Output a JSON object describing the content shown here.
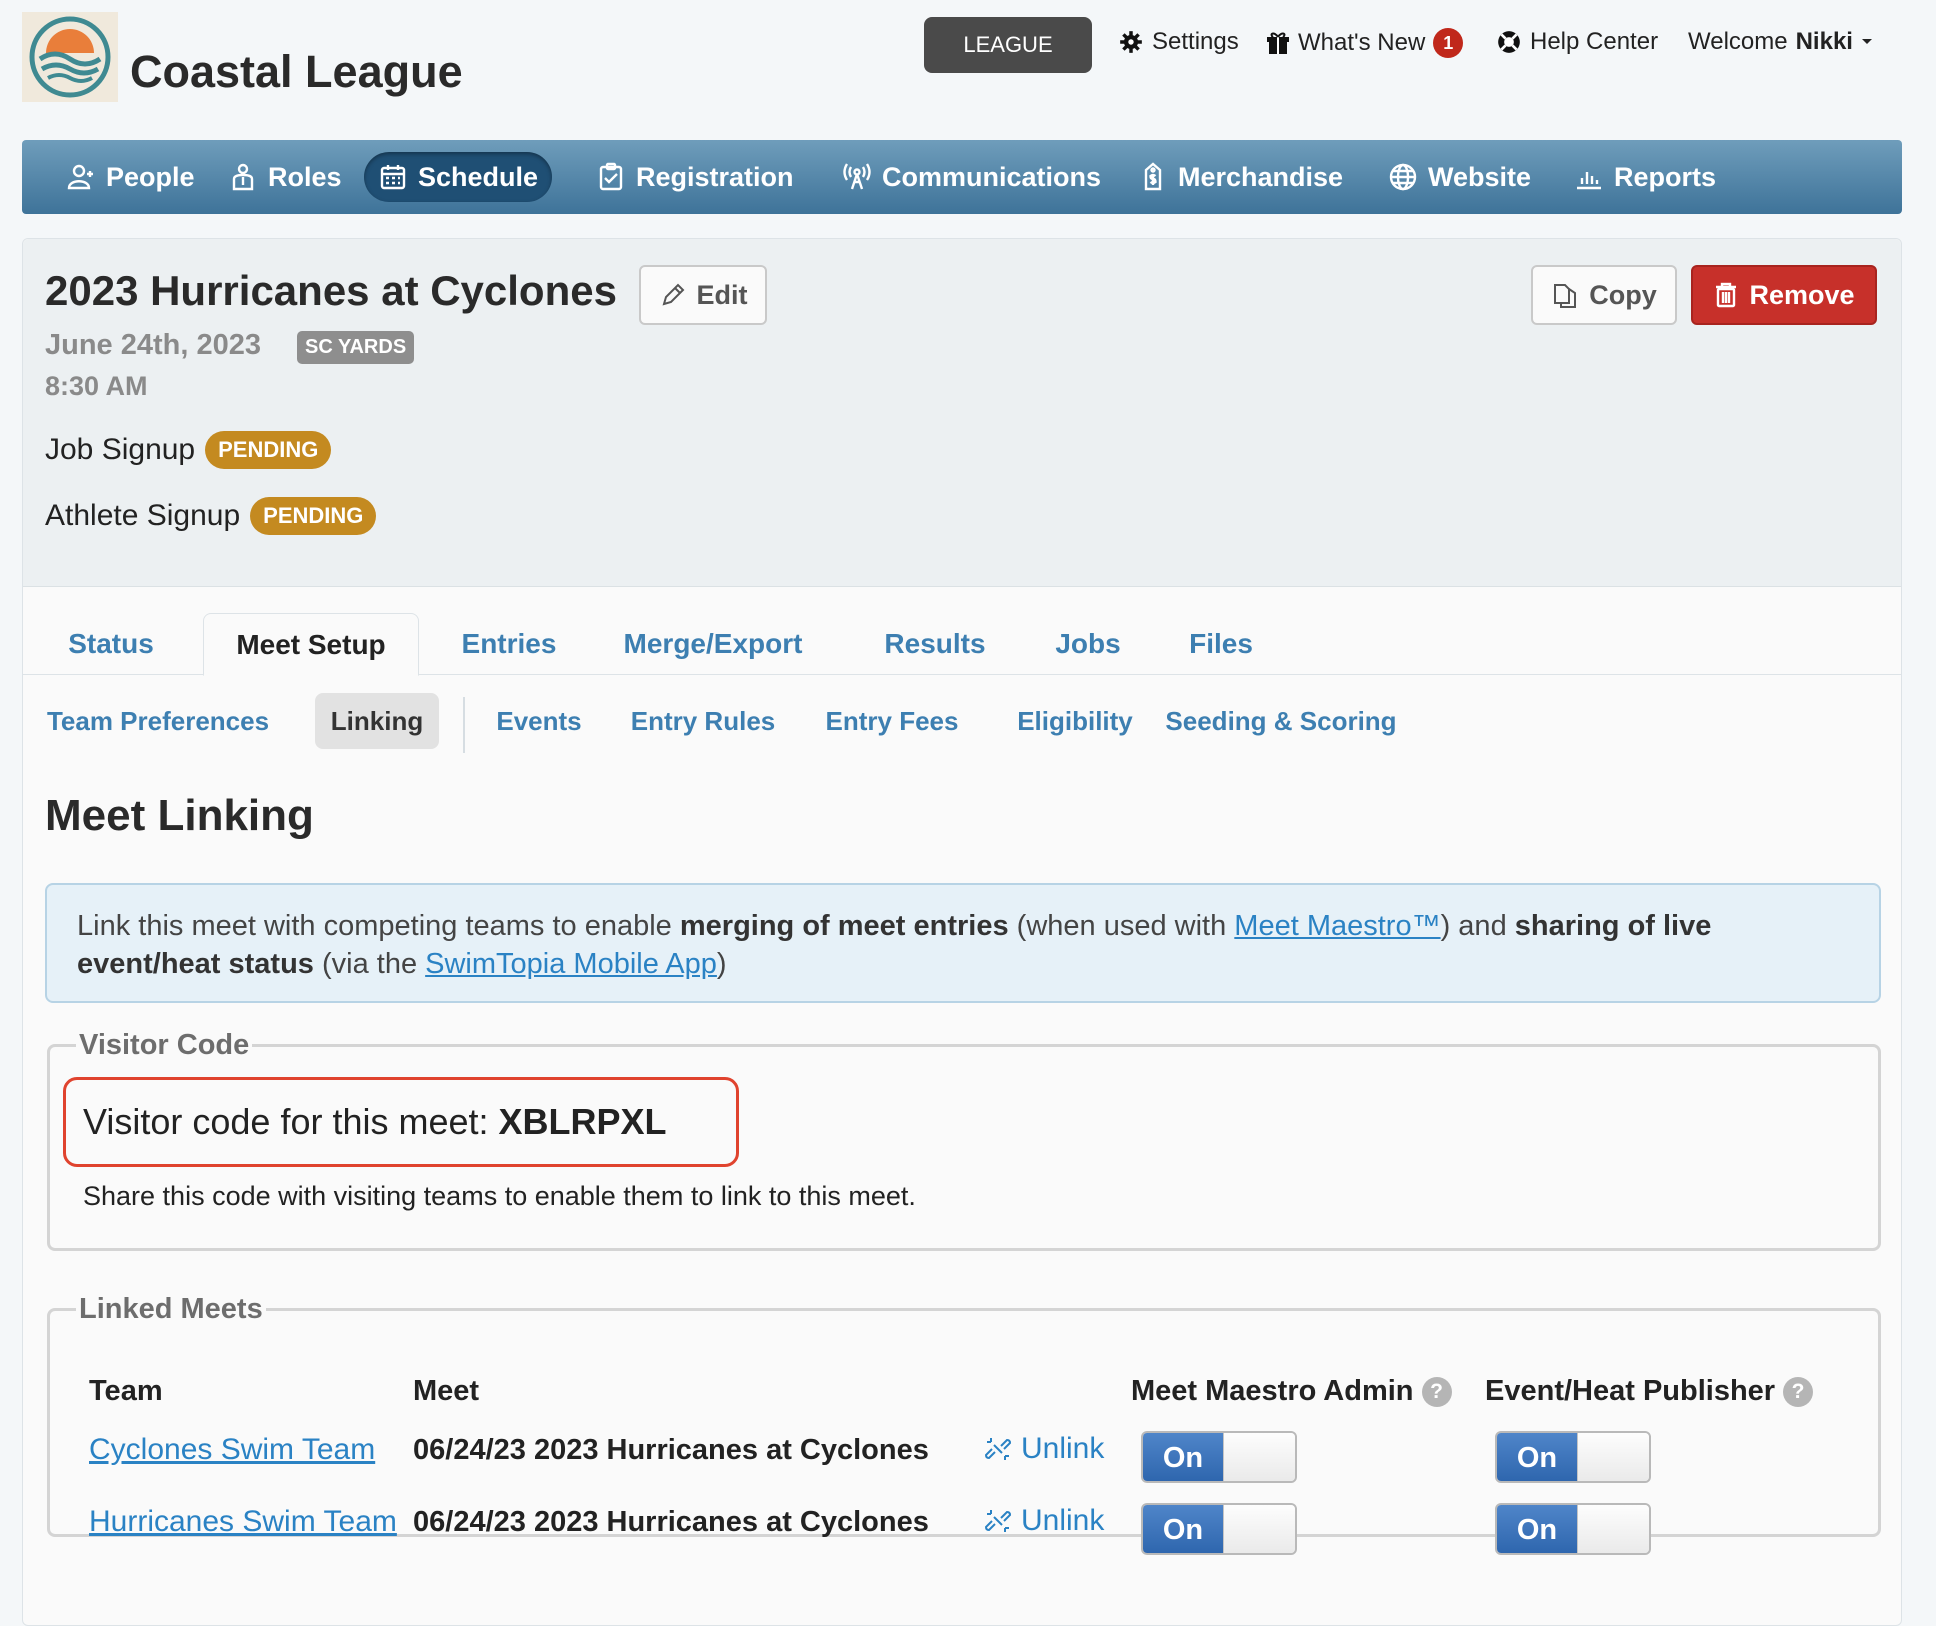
{
  "header": {
    "league_name": "Coastal League",
    "league_button": "LEAGUE",
    "settings": "Settings",
    "whats_new": "What's New",
    "whats_new_count": "1",
    "help_center": "Help Center",
    "welcome_prefix": "Welcome",
    "user_name": "Nikki"
  },
  "nav": {
    "people": "People",
    "roles": "Roles",
    "schedule": "Schedule",
    "registration": "Registration",
    "communications": "Communications",
    "merchandise": "Merchandise",
    "website": "Website",
    "reports": "Reports",
    "active": "Schedule"
  },
  "event": {
    "title": "2023 Hurricanes at Cyclones",
    "edit_label": "Edit",
    "copy_label": "Copy",
    "remove_label": "Remove",
    "date": "June 24th, 2023",
    "course": "SC YARDS",
    "time": "8:30 AM",
    "job_signup_label": "Job Signup",
    "job_signup_status": "PENDING",
    "athlete_signup_label": "Athlete Signup",
    "athlete_signup_status": "PENDING"
  },
  "tabs": [
    "Status",
    "Meet Setup",
    "Entries",
    "Merge/Export",
    "Results",
    "Jobs",
    "Files"
  ],
  "active_tab": "Meet Setup",
  "subtabs": [
    "Team Preferences",
    "Linking",
    "Events",
    "Entry Rules",
    "Entry Fees",
    "Eligibility",
    "Seeding & Scoring"
  ],
  "active_subtab": "Linking",
  "main": {
    "title": "Meet Linking",
    "info": {
      "part1": "Link this meet with competing teams to enable ",
      "bold1": "merging of meet entries",
      "part2": " (when used with ",
      "link1": "Meet Maestro™",
      "part3": ") and ",
      "bold2": "sharing of live event/heat status",
      "part4": " (via the ",
      "link2": "SwimTopia Mobile App",
      "part5": ")"
    },
    "visitor": {
      "legend": "Visitor Code",
      "prefix": "Visitor code for this meet: ",
      "code": "XBLRPXL",
      "note": "Share this code with visiting teams to enable them to link to this meet."
    },
    "linked": {
      "legend": "Linked Meets",
      "headers": {
        "team": "Team",
        "meet": "Meet",
        "admin": "Meet Maestro Admin",
        "publisher": "Event/Heat Publisher"
      },
      "help_glyph": "?",
      "unlink_label": "Unlink",
      "toggle_label": "On",
      "rows": [
        {
          "team": "Cyclones Swim Team",
          "meet": "06/24/23 2023 Hurricanes at Cyclones",
          "admin": "On",
          "publisher": "On"
        },
        {
          "team": "Hurricanes Swim Team",
          "meet": "06/24/23 2023 Hurricanes at Cyclones",
          "admin": "On",
          "publisher": "On"
        }
      ]
    }
  },
  "colors": {
    "nav_gradient_top": "#6f9dbb",
    "nav_gradient_bottom": "#3e7399",
    "link_blue": "#3d7fb1",
    "remove_red": "#c7302a",
    "pending_gold": "#c48a20",
    "highlight_red": "#e0432e"
  },
  "icons": [
    "logo-icon",
    "gear-icon",
    "gift-icon",
    "lifebuoy-icon",
    "caret-down-icon",
    "people-icon",
    "roles-icon",
    "calendar-icon",
    "clipboard-check-icon",
    "antenna-icon",
    "price-tag-icon",
    "globe-icon",
    "bar-chart-icon",
    "pencil-icon",
    "copy-icon",
    "trash-icon",
    "help-icon",
    "unlink-icon"
  ]
}
